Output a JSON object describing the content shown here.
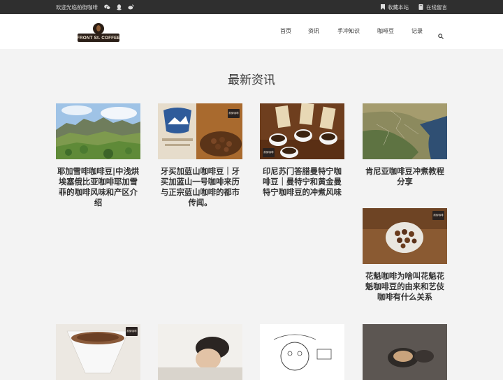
{
  "topbar": {
    "welcome": "欢迎光临前街咖啡",
    "bookmark_label": "收藏本站",
    "message_label": "在线留言"
  },
  "logo": {
    "text": "FRONT St. COFFEE"
  },
  "nav": {
    "items": [
      {
        "label": "首页"
      },
      {
        "label": "资讯"
      },
      {
        "label": "手冲知识"
      },
      {
        "label": "咖啡豆"
      },
      {
        "label": "记录"
      }
    ]
  },
  "section": {
    "title": "最新资讯"
  },
  "badge_text": "前街咖啡",
  "articles": [
    {
      "title": "耶加雪啡咖啡豆|中浅烘埃塞俄比亚咖啡耶加雪菲的咖啡风味和产区介绍"
    },
    {
      "title": "牙买加蓝山咖啡豆｜牙买加蓝山一号咖啡来历与正宗蓝山咖啡的都市传闻。"
    },
    {
      "title": "印尼苏门答腊曼特宁咖啡豆｜曼特宁和黄金曼特宁咖啡豆的冲煮风味"
    },
    {
      "title": "肯尼亚咖啡豆冲煮教程分享"
    },
    {
      "title": "花魁咖啡为啥叫花魁花魁咖啡豆的由来和艺伎咖啡有什么关系"
    }
  ],
  "colors": {
    "topbar_bg": "#2f2f2f",
    "header_bg": "#ffffff",
    "page_bg": "#f3f3f3",
    "text": "#333333"
  }
}
